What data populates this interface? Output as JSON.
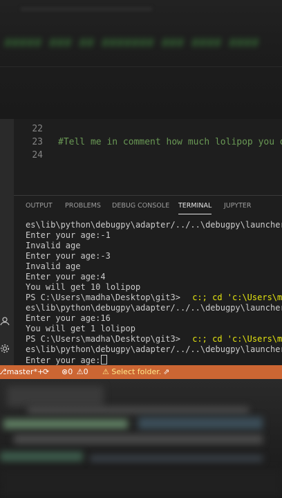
{
  "editor": {
    "lines": [
      {
        "num": "22",
        "text": ""
      },
      {
        "num": "23",
        "text": "#Tell me in comment how much lolipop you d"
      },
      {
        "num": "24",
        "text": ""
      }
    ]
  },
  "panel": {
    "tabs": [
      "OUTPUT",
      "PROBLEMS",
      "DEBUG CONSOLE",
      "TERMINAL",
      "JUPYTER"
    ],
    "active_tab": "TERMINAL"
  },
  "terminal": {
    "lines": [
      "es\\lib\\python\\debugpy\\adapter/../..\\debugpy\\launcher' '",
      "Enter your age:-1",
      "Invalid age",
      "Enter your age:-3",
      "Invalid age",
      "Enter your age:4",
      "You will get 10 lolipop",
      "PS C:\\Users\\madha\\Desktop\\git3>",
      "es\\lib\\python\\debugpy\\adapter/../..\\debugpy\\launcher' '",
      "Enter your age:16",
      "You will get 1 lolipop",
      "PS C:\\Users\\madha\\Desktop\\git3>",
      "es\\lib\\python\\debugpy\\adapter/../..\\debugpy\\launcher' '",
      "Enter your age:"
    ],
    "cmd_fragment_1": "c:; cd 'c:\\Users\\madha",
    "cmd_fragment_2": "c:; cd 'c:\\Users\\madha"
  },
  "status_bar": {
    "branch": "master*+",
    "sync_icon": "sync-icon",
    "errors": "0",
    "warnings": "0",
    "select_folder": "Select folder.",
    "colors": {
      "background": "#cc6633",
      "text": "#ffffff"
    }
  },
  "icons": {
    "account": "account-icon",
    "settings": "gear-icon",
    "branch": "branch-icon",
    "error": "error-icon",
    "warning": "warning-icon"
  }
}
